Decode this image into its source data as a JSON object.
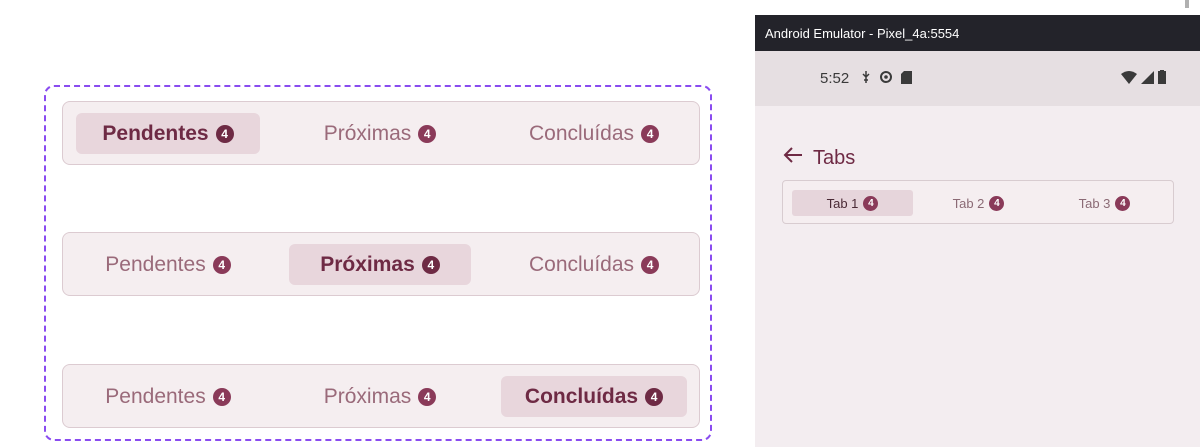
{
  "design": {
    "rows": [
      {
        "tabs": [
          {
            "label": "Pendentes",
            "badge": "4",
            "active": true
          },
          {
            "label": "Próximas",
            "badge": "4",
            "active": false
          },
          {
            "label": "Concluídas",
            "badge": "4",
            "active": false
          }
        ]
      },
      {
        "tabs": [
          {
            "label": "Pendentes",
            "badge": "4",
            "active": false
          },
          {
            "label": "Próximas",
            "badge": "4",
            "active": true
          },
          {
            "label": "Concluídas",
            "badge": "4",
            "active": false
          }
        ]
      },
      {
        "tabs": [
          {
            "label": "Pendentes",
            "badge": "4",
            "active": false
          },
          {
            "label": "Próximas",
            "badge": "4",
            "active": false
          },
          {
            "label": "Concluídas",
            "badge": "4",
            "active": true
          }
        ]
      }
    ]
  },
  "emulator": {
    "window_title": "Android Emulator - Pixel_4a:5554",
    "status_time": "5:52",
    "status_icons_left": [
      "usb-debug-icon",
      "settings-icon",
      "sd-card-icon"
    ],
    "status_icons_right": [
      "wifi-icon",
      "signal-icon",
      "battery-icon"
    ],
    "app_bar_title": "Tabs",
    "tabs": [
      {
        "label": "Tab 1",
        "badge": "4",
        "active": true
      },
      {
        "label": "Tab 2",
        "badge": "4",
        "active": false
      },
      {
        "label": "Tab 3",
        "badge": "4",
        "active": false
      }
    ]
  },
  "colors": {
    "frame_dash": "#8a4cf0",
    "active_tab_bg": "#e8d6dc",
    "active_text": "#6e2a44",
    "inactive_text": "#9a6a7a",
    "badge": "#8a3a59"
  }
}
